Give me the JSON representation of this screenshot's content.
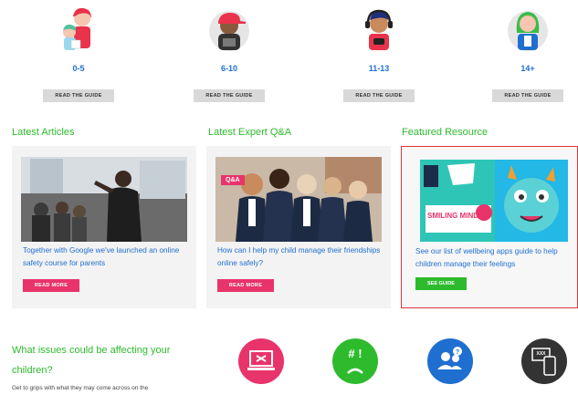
{
  "age_guides": [
    {
      "label": "0-5",
      "button": "READ THE GUIDE",
      "icon": "parent-and-child-avatar-icon"
    },
    {
      "label": "6-10",
      "button": "READ THE GUIDE",
      "icon": "child-with-cap-avatar-icon"
    },
    {
      "label": "11-13",
      "button": "READ THE GUIDE",
      "icon": "child-with-headphones-avatar-icon"
    },
    {
      "label": "14+",
      "button": "READ THE GUIDE",
      "icon": "teen-avatar-icon"
    }
  ],
  "sections": {
    "articles": {
      "title": "Latest Articles",
      "text": "Together with Google we've launched an online safety course for parents",
      "button": "READ MORE"
    },
    "qa": {
      "title": "Latest Expert Q&A",
      "badge": "Q&A",
      "text": "How can I help my child manage their friendships online safely?",
      "button": "READ MORE"
    },
    "featured": {
      "title": "Featured Resource",
      "image_text": "SMILING MIND",
      "text": "See our list of wellbeing apps guide to help children manage their feelings",
      "button": "SEE GUIDE"
    }
  },
  "issues": {
    "title": "What issues could be affecting your children?",
    "text": "Get to grips with what they may come across on the",
    "icons": [
      {
        "name": "laptop-warning-icon",
        "color": "#e8336b"
      },
      {
        "name": "cyberbullying-sad-icon",
        "color": "#2dbb2d"
      },
      {
        "name": "people-question-icon",
        "color": "#1f6fd1"
      },
      {
        "name": "phone-xxx-icon",
        "color": "#333333"
      }
    ],
    "icon_text": {
      "cyberbullying": "# !",
      "phone": "XXX"
    }
  }
}
